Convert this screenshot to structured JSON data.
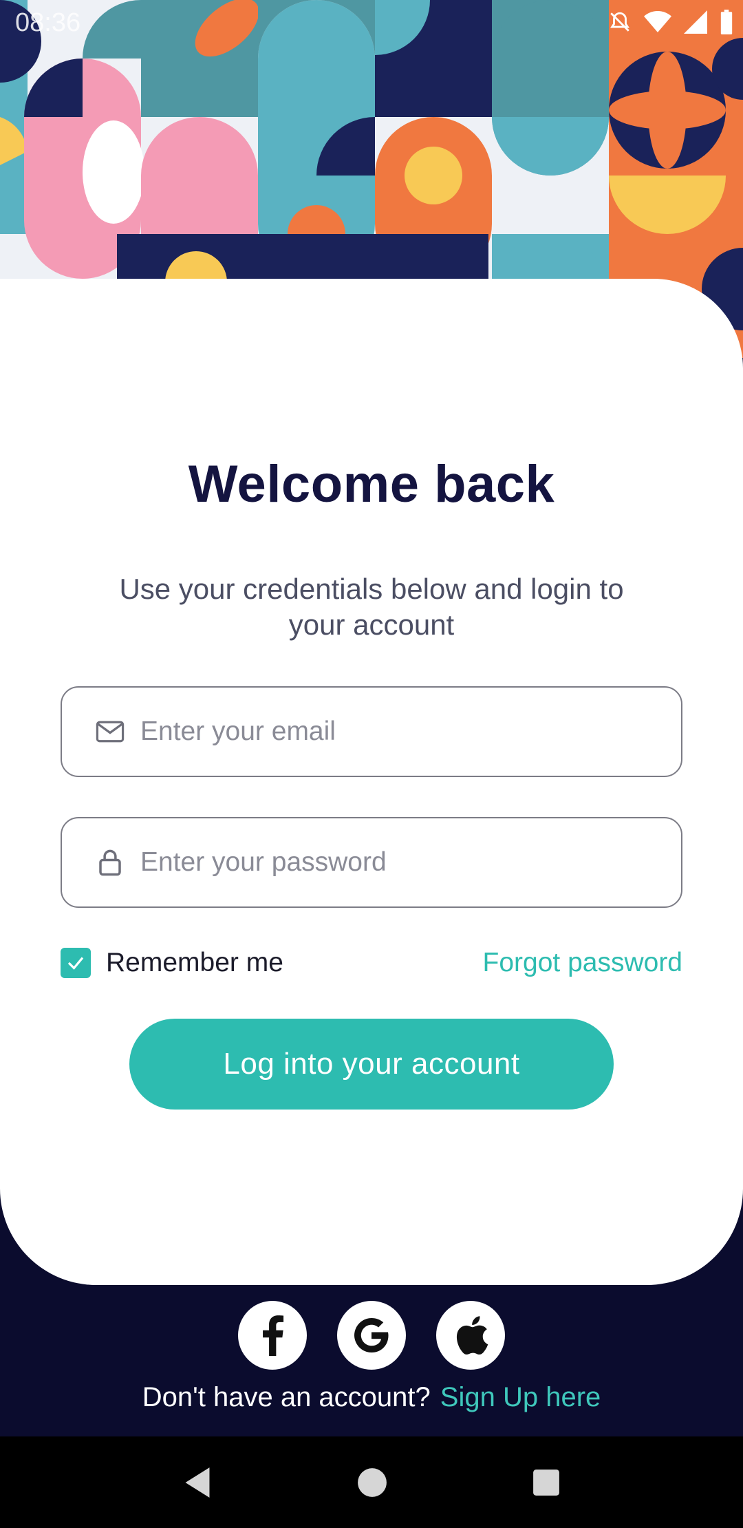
{
  "status_bar": {
    "time": "08:36",
    "icons": [
      "bell-off-icon",
      "wifi-icon",
      "signal-icon",
      "battery-icon"
    ]
  },
  "login": {
    "title": "Welcome back",
    "subtitle": "Use your credentials below and login to your account",
    "email_placeholder": "Enter your email",
    "password_placeholder": "Enter your password",
    "remember_label": "Remember me",
    "remember_checked": true,
    "forgot_label": "Forgot password",
    "login_button": "Log into your account"
  },
  "social": {
    "providers": [
      "facebook-icon",
      "google-icon",
      "apple-icon"
    ]
  },
  "signup": {
    "prompt": "Don't have an account?",
    "link": "Sign Up here"
  },
  "colors": {
    "accent": "#2DBCB0",
    "dark": "#0B0C2E",
    "title": "#141440"
  }
}
